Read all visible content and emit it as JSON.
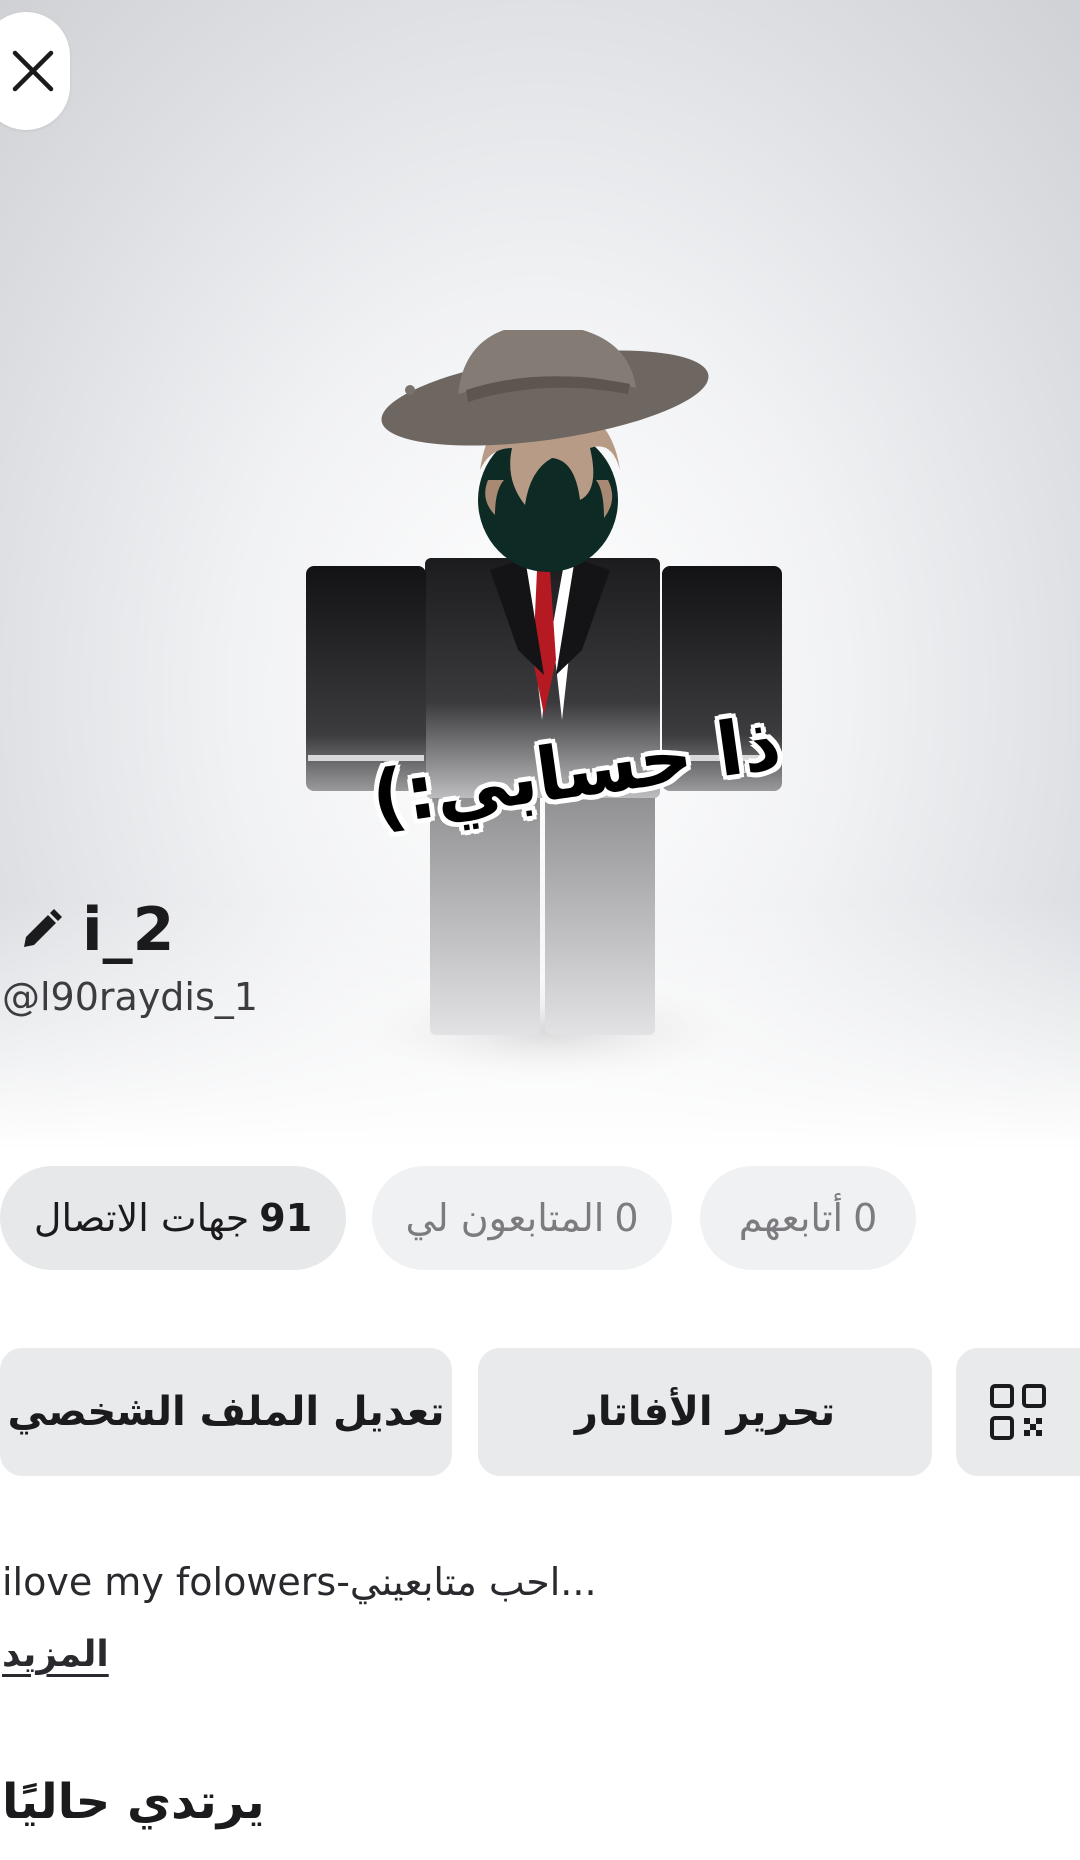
{
  "header": {
    "close_icon": "close-icon"
  },
  "overlay": {
    "caption": "ذا حسابي:)"
  },
  "profile": {
    "display_name": "i_2",
    "username": "@l90raydis_1",
    "edit_icon": "pencil-icon"
  },
  "stats": {
    "connections": {
      "count": "91",
      "label": "جهات الاتصال"
    },
    "followers": {
      "count": "0",
      "label": "المتابعون لي"
    },
    "following": {
      "count": "0",
      "label": "أتابعهم"
    }
  },
  "actions": {
    "edit_profile": "تعديل الملف الشخصي",
    "edit_avatar": "تحرير الأفاتار",
    "qr_icon": "qr-code-icon"
  },
  "bio": {
    "text": "ilove my folowers-احب متابعيني...",
    "more": "المزيد"
  },
  "currently_wearing": {
    "title": "يرتدي حاليًا"
  }
}
